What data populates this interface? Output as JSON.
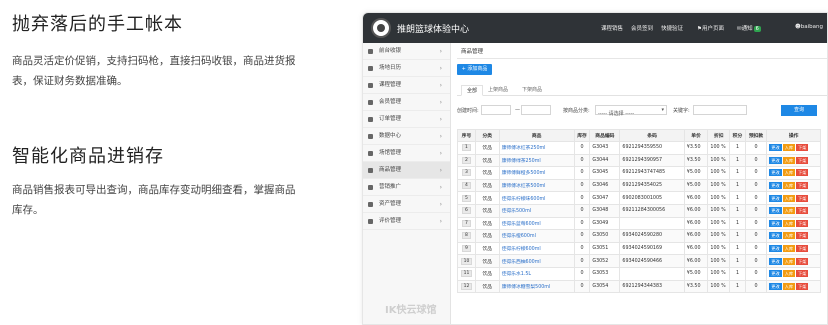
{
  "features": [
    {
      "title": "抛弃落后的手工帐本",
      "desc": "商品灵活定价促销，支持扫码枪，直接扫码收银，商品进货报表，保证财务数据准确。"
    },
    {
      "title": "智能化商品进销存",
      "desc": "商品销售报表可导出查询，商品库存变动明细查看，掌握商品库存。"
    }
  ],
  "app": {
    "title": "推朗篮球体验中心",
    "nav": [
      "课程销售",
      "会员签到",
      "快捷验证",
      "用户页面",
      "通知"
    ],
    "notify_count": "6",
    "user": "baibang"
  },
  "sidebar": {
    "items": [
      "前台收银",
      "场地日历",
      "课程管理",
      "会员管理",
      "订单管理",
      "数据中心",
      "场馆管理",
      "商品管理",
      "营销推广",
      "资产管理",
      "评价管理"
    ],
    "active": "商品管理",
    "watermark": "IK快云球馆"
  },
  "page": {
    "breadcrumb": "商品管理",
    "add_button": "+ 添加商品",
    "tabs": [
      "全部",
      "上架商品",
      "下架商品"
    ],
    "filter": {
      "created_label": "创建时间:",
      "range_sep": "—",
      "category_label": "按商品分类:",
      "category_value": "----- 请选择 -----",
      "keyword_label": "关键字:",
      "search_button": "查询"
    }
  },
  "table": {
    "headers": [
      "序号",
      "分类",
      "商品",
      "库存",
      "商品编码",
      "条码",
      "单价",
      "折扣",
      "积分",
      "预扣款",
      "操作"
    ],
    "rows": [
      [
        "1",
        "饮品",
        "康师傅冰红茶250ml",
        "0",
        "G3043",
        "6921294359550",
        "¥3.50",
        "100 %",
        "1",
        "0"
      ],
      [
        "2",
        "饮品",
        "康师傅绿茶250ml",
        "0",
        "G3044",
        "6921294390957",
        "¥3.50",
        "100 %",
        "1",
        "0"
      ],
      [
        "3",
        "饮品",
        "康师傅鲜橙多500ml",
        "0",
        "G3045",
        "69212943747485",
        "¥5.00",
        "100 %",
        "1",
        "0"
      ],
      [
        "4",
        "饮品",
        "康师傅冰红茶500ml",
        "0",
        "G3046",
        "6921294354025",
        "¥5.00",
        "100 %",
        "1",
        "0"
      ],
      [
        "5",
        "饮品",
        "佳得乐柠檬味600ml",
        "0",
        "G3047",
        "6902083001005",
        "¥6.00",
        "100 %",
        "1",
        "0"
      ],
      [
        "6",
        "饮品",
        "佳得乐500ml",
        "0",
        "G3048",
        "69211284300056",
        "¥6.00",
        "100 %",
        "1",
        "0"
      ],
      [
        "7",
        "饮品",
        "佳得乐蓝莓600ml",
        "0",
        "G3049",
        "",
        "¥6.00",
        "100 %",
        "1",
        "0"
      ],
      [
        "8",
        "饮品",
        "佳得乐橙600ml",
        "0",
        "G3050",
        "6934024590280",
        "¥6.00",
        "100 %",
        "1",
        "0"
      ],
      [
        "9",
        "饮品",
        "佳得乐柠檬600ml",
        "0",
        "G3051",
        "6934024590169",
        "¥6.00",
        "100 %",
        "1",
        "0"
      ],
      [
        "10",
        "饮品",
        "佳得乐西柚600ml",
        "0",
        "G3052",
        "6934024590466",
        "¥6.00",
        "100 %",
        "1",
        "0"
      ],
      [
        "11",
        "饮品",
        "佳得乐水1.5L",
        "0",
        "G3053",
        "",
        "¥5.00",
        "100 %",
        "1",
        "0"
      ],
      [
        "12",
        "饮品",
        "康师傅冰糖雪梨500ml",
        "0",
        "G3054",
        "6921294344383",
        "¥3.50",
        "100 %",
        "1",
        "0"
      ]
    ],
    "ops": [
      "更改",
      "入库",
      "下架"
    ]
  },
  "colors": {
    "accent": "#1e88e5",
    "topbar": "#2f3337",
    "warn": "#f39c12",
    "danger": "#e74c3c"
  }
}
